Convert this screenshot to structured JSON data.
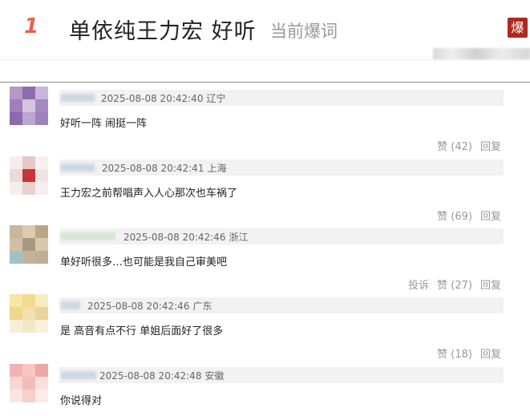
{
  "topic": {
    "rank": "1",
    "title": "单依纯王力宏 好听",
    "tag": "当前爆词",
    "badge": "爆"
  },
  "comments": [
    {
      "time": "2025-08-08 20:42:40",
      "location": "辽宁",
      "text": "好听一阵 闹挺一阵",
      "report": "",
      "like": "赞 (42)",
      "reply": "回复",
      "avatar_colors": [
        "#b49ac7",
        "#8f6cae",
        "#c8b5d8",
        "#9f7fbe",
        "#d5c6e0",
        "#a48ac0",
        "#8c6ab0",
        "#bca6cf",
        "#9d83bd"
      ]
    },
    {
      "time": "2025-08-08 20:42:41",
      "location": "上海",
      "text": "王力宏之前帮唱声入人心那次也车祸了",
      "report": "",
      "like": "赞 (69)",
      "reply": "回复",
      "avatar_colors": [
        "#f4efee",
        "#e7c8c6",
        "#f6f1f0",
        "#eadad8",
        "#c7343a",
        "#f0e4e3",
        "#f5efee",
        "#e9d1cf",
        "#f4eeed"
      ]
    },
    {
      "time": "2025-08-08 20:42:46",
      "location": "浙江",
      "text": "单好听很多…也可能是我自己审美吧",
      "report": "投诉",
      "like": "赞 (27)",
      "reply": "回复",
      "avatar_colors": [
        "#c8b79a",
        "#dccbb0",
        "#b9a888",
        "#cfc0a4",
        "#a99982",
        "#d8c9ae",
        "#9fc2c4",
        "#c4b39a",
        "#bfae94"
      ]
    },
    {
      "time": "2025-08-08 20:42:46",
      "location": "广东",
      "text": "是 高音有点不行 单姐后面好了很多",
      "report": "",
      "like": "赞 (18)",
      "reply": "回复",
      "avatar_colors": [
        "#f6e6a8",
        "#f3dc8e",
        "#f8ecc0",
        "#eed78a",
        "#f1e1b0",
        "#ead49a",
        "#f7efd6",
        "#f5e8c4",
        "#f9f1dc"
      ]
    },
    {
      "time": "2025-08-08 20:42:48",
      "location": "安徽",
      "text": "你说得对",
      "report": "",
      "like": "",
      "reply": "",
      "avatar_colors": [
        "#f3b3b0",
        "#f6c7c3",
        "#efa8a4",
        "#f7d6d3",
        "#f1bdb9",
        "#f8e0dd",
        "#f9e6e4",
        "#f5d0cc",
        "#faeceb"
      ]
    }
  ]
}
